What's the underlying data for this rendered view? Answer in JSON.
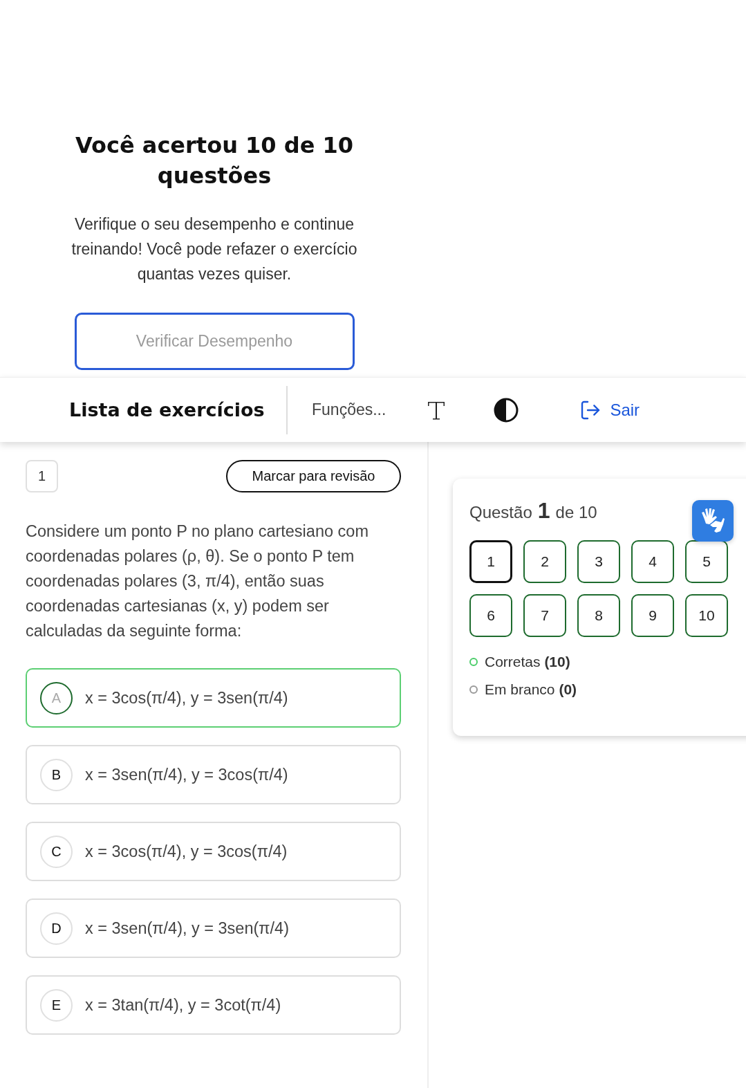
{
  "result": {
    "title": "Você acertou 10 de 10 questões",
    "message": "Verifique o seu desempenho e continue treinando! Você pode refazer o exercício quantas vezes quiser.",
    "button": "Verificar Desempenho"
  },
  "header": {
    "title": "Lista de exercícios",
    "functions": "Funções...",
    "exit": "Sair"
  },
  "question": {
    "number": "1",
    "review_button": "Marcar para revisão",
    "text": "Considere um ponto P no plano cartesiano com coordenadas polares (ρ, θ). Se o ponto P tem coordenadas polares (3, π/4), então suas coordenadas cartesianas (x, y) podem ser calculadas da seguinte forma:",
    "options": [
      {
        "letter": "A",
        "text": "x = 3cos(π/4), y = 3sen(π/4)",
        "correct": true
      },
      {
        "letter": "B",
        "text": "x = 3sen(π/4), y = 3cos(π/4)",
        "correct": false
      },
      {
        "letter": "C",
        "text": "x = 3cos(π/4), y = 3cos(π/4)",
        "correct": false
      },
      {
        "letter": "D",
        "text": "x = 3sen(π/4), y = 3sen(π/4)",
        "correct": false
      },
      {
        "letter": "E",
        "text": "x = 3tan(π/4), y = 3cot(π/4)",
        "correct": false
      }
    ]
  },
  "navigator": {
    "title_prefix": "Questão",
    "current": "1",
    "title_suffix": "de 10",
    "questions": [
      {
        "label": "1",
        "selected": true
      },
      {
        "label": "2",
        "selected": false
      },
      {
        "label": "3",
        "selected": false
      },
      {
        "label": "4",
        "selected": false
      },
      {
        "label": "5",
        "selected": false
      },
      {
        "label": "6",
        "selected": false
      },
      {
        "label": "7",
        "selected": false
      },
      {
        "label": "8",
        "selected": false
      },
      {
        "label": "9",
        "selected": false
      },
      {
        "label": "10",
        "selected": false
      }
    ],
    "legend": [
      {
        "label": "Corretas",
        "count": "(10)",
        "color": "#4ccd6a"
      },
      {
        "label": "Em branco",
        "count": "(0)",
        "color": "#9a9a9a"
      }
    ]
  }
}
